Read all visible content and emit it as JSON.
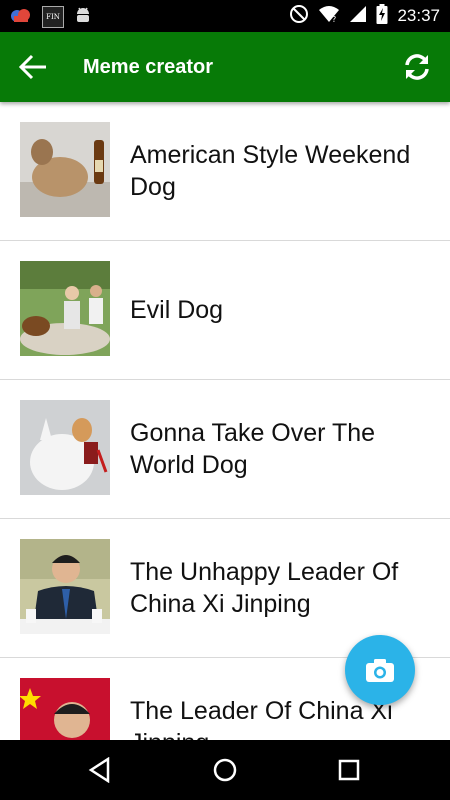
{
  "status_bar": {
    "time": "23:37",
    "left_icons": [
      "cloud-icon",
      "fin-app-icon",
      "android-icon"
    ],
    "fin_label": "FIN",
    "right_icons": [
      "do-not-disturb-icon",
      "wifi-icon",
      "cell-signal-icon",
      "battery-charging-icon"
    ]
  },
  "app_bar": {
    "title": "Meme creator",
    "back_icon": "arrow-left-icon",
    "refresh_icon": "refresh-icon",
    "color": "#077a07"
  },
  "memes": [
    {
      "title": "American Style Weekend Dog",
      "thumb": "dog-sitting-with-beer"
    },
    {
      "title": "Evil Dog",
      "thumb": "couple-picnic-with-dog"
    },
    {
      "title": "Gonna Take Over The World Dog",
      "thumb": "dog-on-white-robot"
    },
    {
      "title": "The Unhappy Leader Of China Xi Jinping",
      "thumb": "man-in-suit-at-table"
    },
    {
      "title": "The Leader Of China Xi Jinping",
      "thumb": "man-with-red-flag"
    }
  ],
  "fab": {
    "icon": "camera-icon",
    "color": "#2bb3e8"
  },
  "nav_bar": {
    "icons": [
      "back-triangle-icon",
      "home-circle-icon",
      "recents-square-icon"
    ]
  }
}
